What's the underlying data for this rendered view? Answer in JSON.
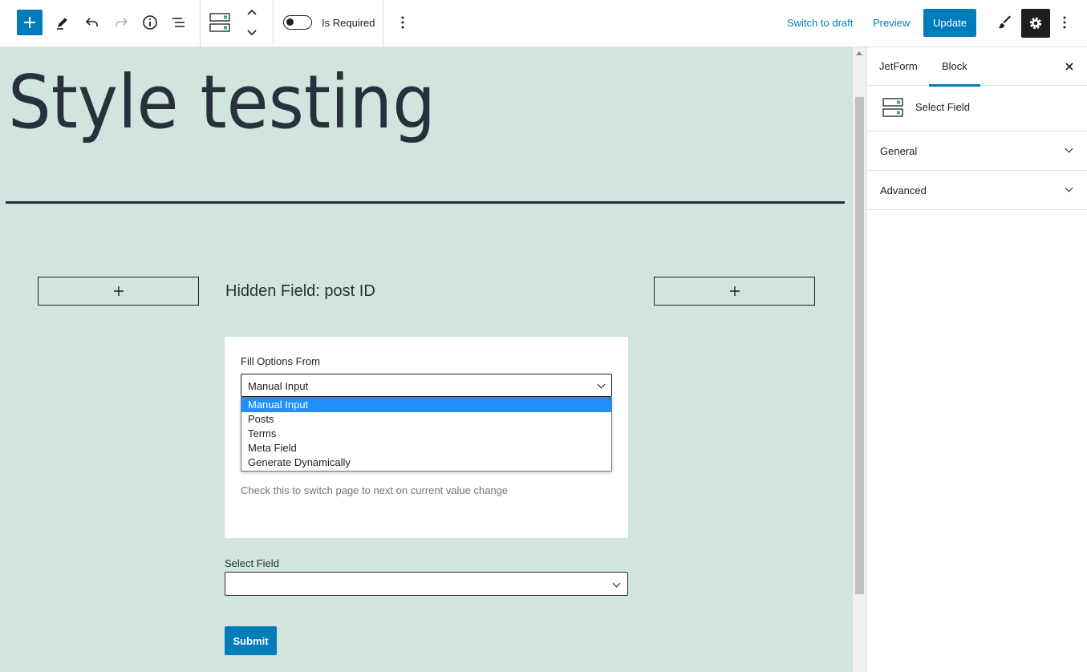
{
  "toolbar": {
    "is_required_label": "Is Required",
    "switch_to_draft": "Switch to draft",
    "preview": "Preview",
    "update": "Update",
    "icons": [
      "plus-icon",
      "pencil-icon",
      "undo-icon",
      "redo-icon",
      "info-icon",
      "list-view-icon",
      "select-field-block-icon",
      "chevron-up-icon",
      "chevron-down-icon",
      "more-vertical-icon",
      "brush-icon",
      "gear-icon"
    ]
  },
  "canvas": {
    "page_title": "Style testing",
    "hidden_field_label": "Hidden Field: post ID",
    "appender_symbol": "+",
    "options_panel": {
      "label": "Fill Options From",
      "selected": "Manual Input",
      "options": [
        "Manual Input",
        "Posts",
        "Terms",
        "Meta Field",
        "Generate Dynamically"
      ],
      "help_text": "Check this to switch page to next on current value change"
    },
    "select_field_label": "Select Field",
    "select_field_value": "",
    "submit_label": "Submit"
  },
  "sidebar": {
    "tabs": [
      "JetForm",
      "Block"
    ],
    "active_tab": "Block",
    "block_name": "Select Field",
    "sections": [
      "General",
      "Advanced"
    ]
  },
  "colors": {
    "accent": "#007cba",
    "canvas_bg": "#d1e4dd",
    "text_dark": "#28303d",
    "dropdown_highlight": "#1e90ff"
  }
}
